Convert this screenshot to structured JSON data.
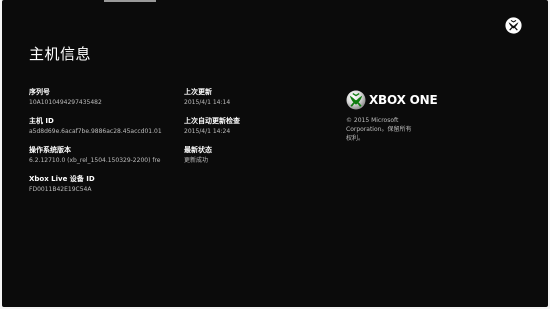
{
  "page": {
    "title": "主机信息"
  },
  "fields": {
    "serial": {
      "label": "序列号",
      "value": "10A1010494297435482"
    },
    "console_id": {
      "label": "主机 ID",
      "value": "a5d8d69e.6acaf7be.9886ac28.45accd01.01"
    },
    "os_version": {
      "label": "操作系统版本",
      "value": "6.2.12710.0 (xb_rel_1504.150329-2200) fre"
    },
    "live_id": {
      "label": "Xbox Live 设备 ID",
      "value": "FD0011B42E19C54A"
    },
    "last_update": {
      "label": "上次更新",
      "value": "2015/4/1 14:14"
    },
    "last_auto_check": {
      "label": "上次自动更新检查",
      "value": "2015/4/1 14:24"
    },
    "latest_status": {
      "label": "最新状态",
      "value": "更新成功"
    }
  },
  "brand": {
    "logo_text": "XBOX ONE",
    "copyright": "© 2015 Microsoft Corporation。保留所有权利。",
    "logo_color": "#107c10"
  },
  "icons": {
    "home_button": "xbox-guide-button-icon",
    "logo_sphere": "xbox-sphere-icon"
  }
}
